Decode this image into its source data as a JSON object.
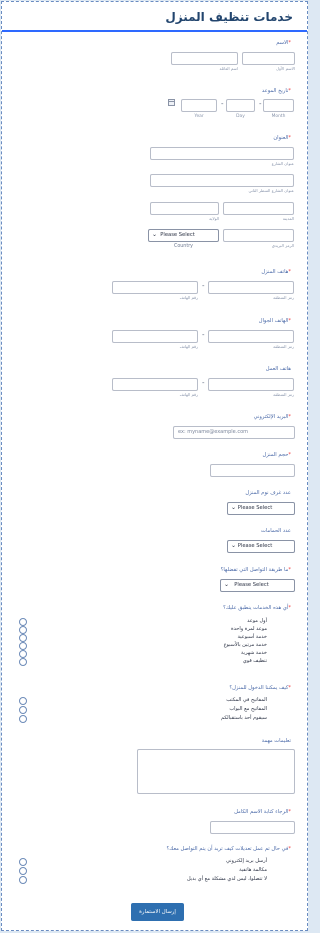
{
  "form": {
    "title": "خدمات تنظيف المنزل",
    "name": {
      "label": "الاسم",
      "first_sub": "الاسم الأول",
      "last_sub": "اسم العائلة"
    },
    "date": {
      "label": "تاريخ الموعد",
      "month": "Month",
      "day": "Day",
      "year": "Year"
    },
    "address": {
      "label": "العنوان",
      "street_sub": "عنوان الشارع",
      "street2_sub": "عنوان الشارع السطر الثاني",
      "city_sub": "المدينة",
      "state_sub": "الولاية",
      "zip_sub": "الرمز البريدي",
      "country_sub": "Country",
      "country_value": "Please Select"
    },
    "home_phone": {
      "label": "هاتف المنزل",
      "area_sub": "رمز المنطقة",
      "number_sub": "رقم الهاتف"
    },
    "mobile_phone": {
      "label": "الهاتف الجوال",
      "area_sub": "رمز المنطقة",
      "number_sub": "رقم الهاتف"
    },
    "work_phone": {
      "label": "هاتف العمل",
      "area_sub": "رمز المنطقة",
      "number_sub": "رقم الهاتف"
    },
    "email": {
      "label": "البريد الإلكتروني",
      "placeholder": "ex: myname@example.com"
    },
    "home_size": {
      "label": "حجم المنزل"
    },
    "rooms": {
      "label": "عدد غرف نوم المنزل",
      "value": "Please Select"
    },
    "bathrooms": {
      "label": "عدد الحمامات",
      "value": "Please Select"
    },
    "contact_method": {
      "label": "ما طريقة التواصل التي تفضلها؟",
      "value": "Please Select"
    },
    "services": {
      "label": "أي هذه الخدمات ينطبق عليك؟",
      "options": [
        "أول موعد",
        "موعد لمرة واحدة",
        "خدمة أسبوعية",
        "خدمة مرتين بالأسبوع",
        "خدمة شهرية",
        "تنظيف قوي"
      ]
    },
    "access": {
      "label": "كيف يمكننا الدخول للمنزل؟",
      "options": [
        "المفاتيح في المكتب",
        "المفاتيح مع البواب",
        "سيقوم أحد باستقبالكم"
      ]
    },
    "instructions": {
      "label": "تعليمات مهمة"
    },
    "signature": {
      "label": "الرجاء كتابة الاسم الكامل"
    },
    "change_contact": {
      "label": "في حال تم عمل تعديلات كيف تريد أن يتم التواصل معك؟",
      "options": [
        "أرسل بريد إلكتروني",
        "مكالمة هاتفية",
        "لا تتصلوا، ليس لدي مشكلة مع أي بديل"
      ]
    },
    "submit_label": "إرسال الاستمارة"
  }
}
